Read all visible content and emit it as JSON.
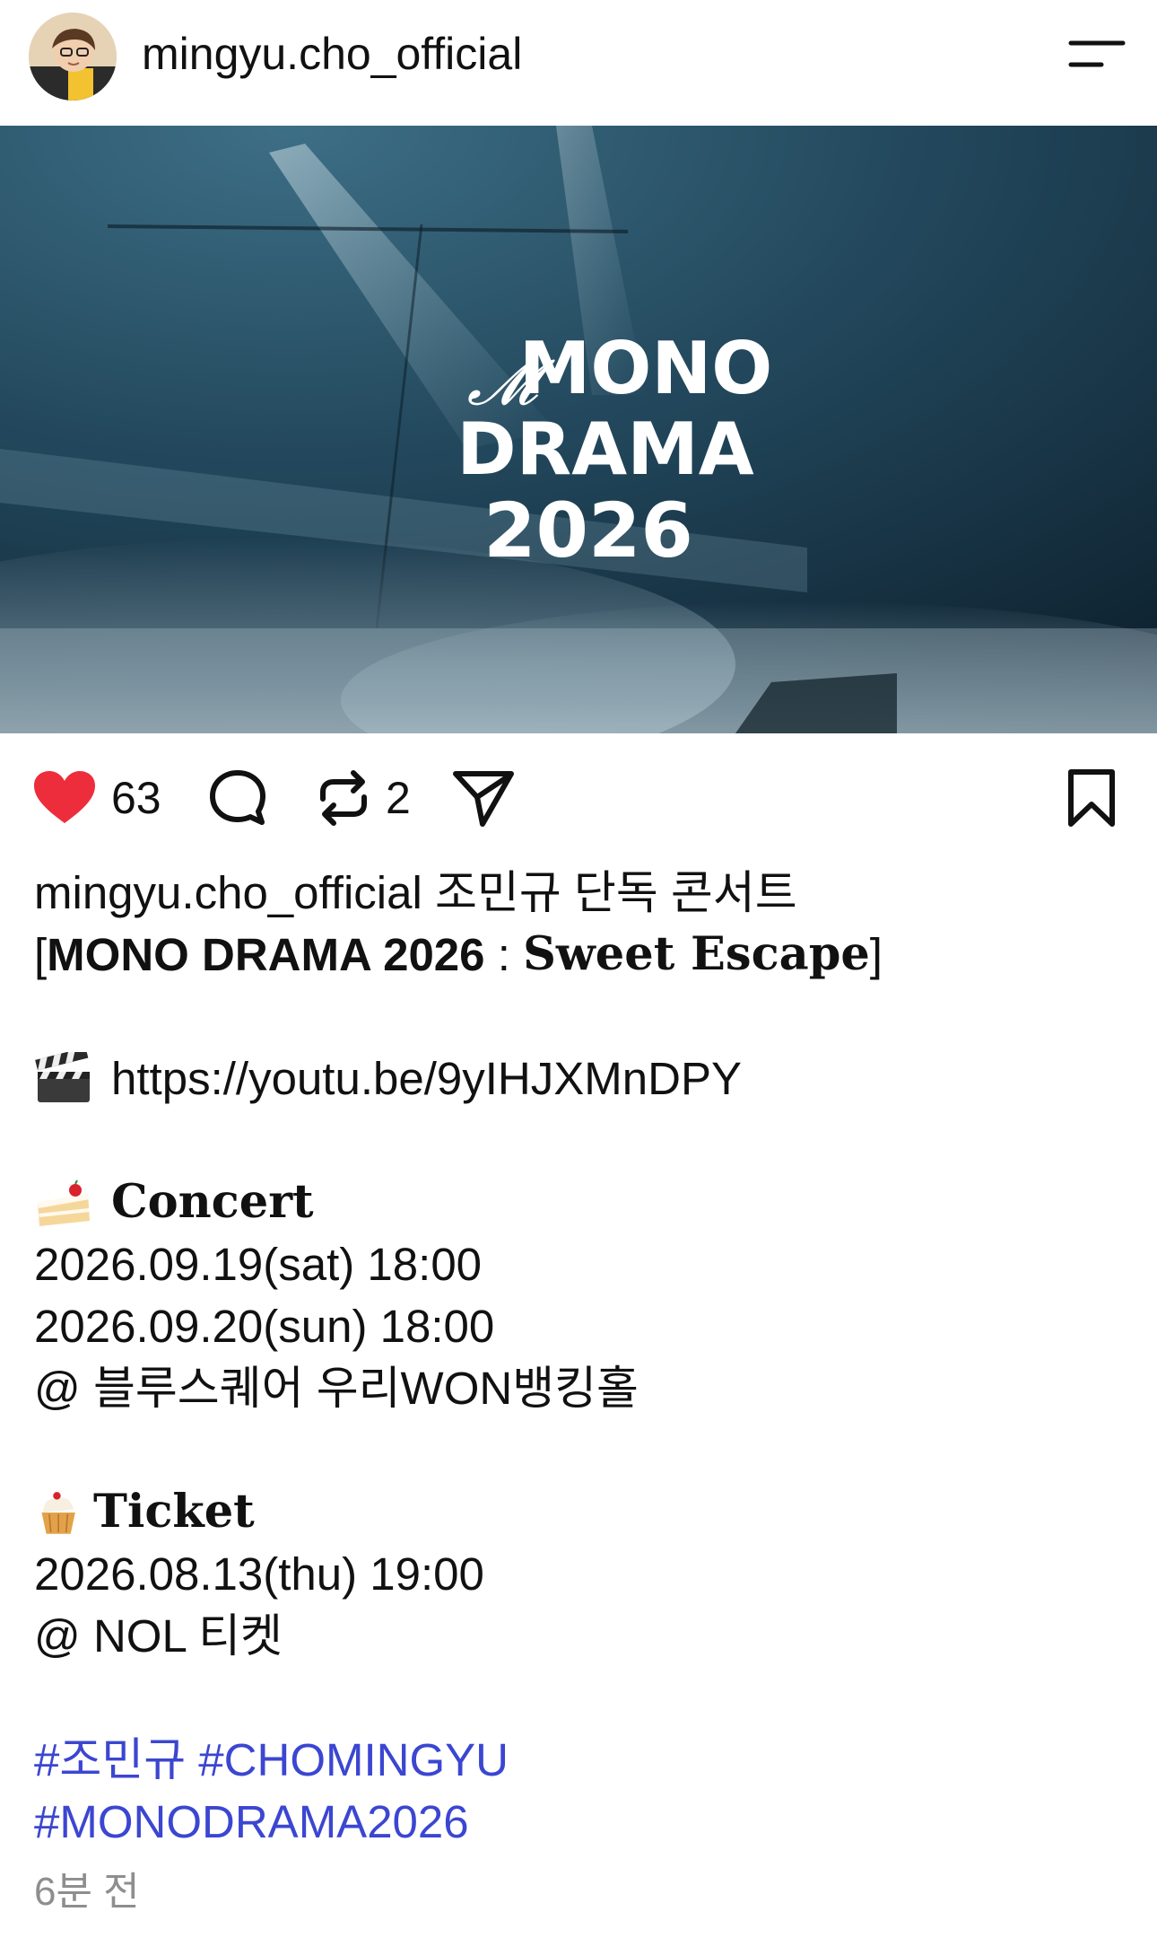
{
  "header": {
    "username": "mingyu.cho_official",
    "avatar_icon": "profile-photo",
    "menu_icon": "menu-lines-icon"
  },
  "media": {
    "title_line1": "MONO",
    "title_line2": "DRAMA",
    "title_line3": "2026",
    "background_colors": {
      "deep": "#0e2535",
      "mid": "#2c5a72",
      "fog": "#b8c7cf"
    }
  },
  "actions": {
    "likes": "63",
    "reposts": "2",
    "like_color": "#ed2d3c"
  },
  "caption": {
    "username": "mingyu.cho_official",
    "line1_text": " 조민규 단독 콘서트",
    "line2_open": "[",
    "line2_bold": "MONO DRAMA 2026",
    "line2_sep": " : ",
    "line2_serif": "Sweet Escape",
    "line2_close": "]",
    "link": "https://youtu.be/9yIHJXMnDPY",
    "concert_heading": "Concert",
    "concert_date1": "2026.09.19(sat) 18:00",
    "concert_date2": "2026.09.20(sun) 18:00",
    "concert_venue": "@ 블루스퀘어 우리WON뱅킹홀",
    "ticket_heading": "Ticket",
    "ticket_date": "2026.08.13(thu) 19:00",
    "ticket_venue": "@ NOL 티켓",
    "hashtags_line1": "#조민규 #CHOMINGYU",
    "hashtags_line2": "#MONODRAMA2026",
    "hashtag_color": "#3b46d1"
  },
  "timestamp": "6분 전"
}
